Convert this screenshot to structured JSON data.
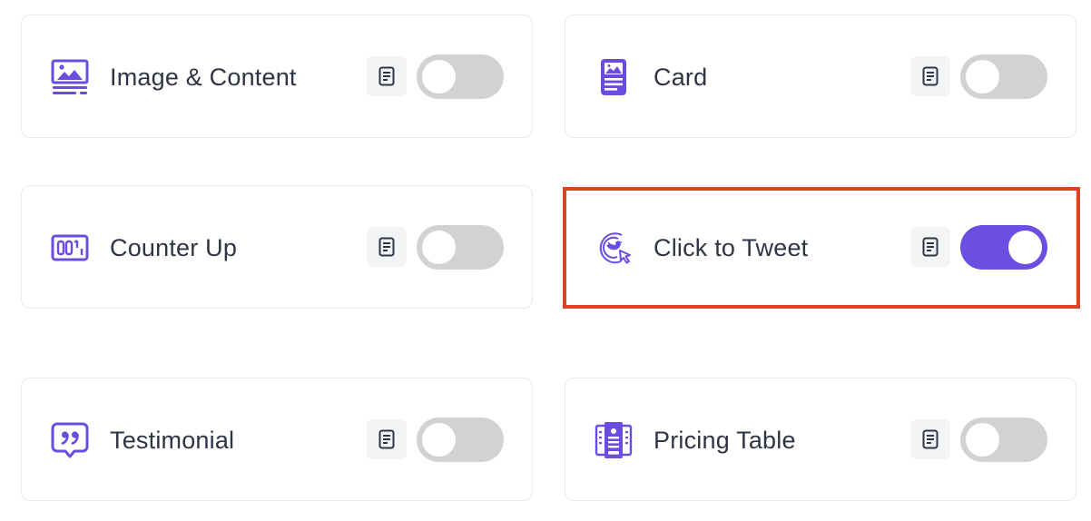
{
  "colors": {
    "accent": "#6b4fe0",
    "icon": "#6a4de0",
    "toggle_off": "#d2d2d2",
    "highlight": "#dc4326"
  },
  "widgets": [
    {
      "label": "Image & Content",
      "icon": "image-content-icon",
      "enabled": false
    },
    {
      "label": "Card",
      "icon": "card-icon",
      "enabled": false
    },
    {
      "label": "Counter Up",
      "icon": "counter-up-icon",
      "enabled": false
    },
    {
      "label": "Click to Tweet",
      "icon": "click-to-tweet-icon",
      "enabled": true
    },
    {
      "label": "Testimonial",
      "icon": "testimonial-icon",
      "enabled": false
    },
    {
      "label": "Pricing Table",
      "icon": "pricing-table-icon",
      "enabled": false
    }
  ]
}
